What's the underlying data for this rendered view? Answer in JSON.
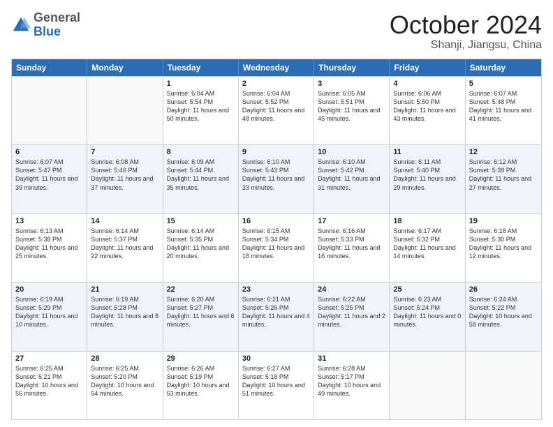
{
  "logo": {
    "general": "General",
    "blue": "Blue"
  },
  "header": {
    "month": "October 2024",
    "location": "Shanji, Jiangsu, China"
  },
  "weekdays": [
    "Sunday",
    "Monday",
    "Tuesday",
    "Wednesday",
    "Thursday",
    "Friday",
    "Saturday"
  ],
  "rows": [
    [
      {
        "day": "",
        "empty": true
      },
      {
        "day": "",
        "empty": true
      },
      {
        "day": "1",
        "sunrise": "6:04 AM",
        "sunset": "5:54 PM",
        "daylight": "11 hours and 50 minutes."
      },
      {
        "day": "2",
        "sunrise": "6:04 AM",
        "sunset": "5:52 PM",
        "daylight": "11 hours and 48 minutes."
      },
      {
        "day": "3",
        "sunrise": "6:05 AM",
        "sunset": "5:51 PM",
        "daylight": "11 hours and 45 minutes."
      },
      {
        "day": "4",
        "sunrise": "6:06 AM",
        "sunset": "5:50 PM",
        "daylight": "11 hours and 43 minutes."
      },
      {
        "day": "5",
        "sunrise": "6:07 AM",
        "sunset": "5:48 PM",
        "daylight": "11 hours and 41 minutes."
      }
    ],
    [
      {
        "day": "6",
        "sunrise": "6:07 AM",
        "sunset": "5:47 PM",
        "daylight": "11 hours and 39 minutes."
      },
      {
        "day": "7",
        "sunrise": "6:08 AM",
        "sunset": "5:46 PM",
        "daylight": "11 hours and 37 minutes."
      },
      {
        "day": "8",
        "sunrise": "6:09 AM",
        "sunset": "5:44 PM",
        "daylight": "11 hours and 35 minutes."
      },
      {
        "day": "9",
        "sunrise": "6:10 AM",
        "sunset": "5:43 PM",
        "daylight": "11 hours and 33 minutes."
      },
      {
        "day": "10",
        "sunrise": "6:10 AM",
        "sunset": "5:42 PM",
        "daylight": "11 hours and 31 minutes."
      },
      {
        "day": "11",
        "sunrise": "6:11 AM",
        "sunset": "5:40 PM",
        "daylight": "11 hours and 29 minutes."
      },
      {
        "day": "12",
        "sunrise": "6:12 AM",
        "sunset": "5:39 PM",
        "daylight": "11 hours and 27 minutes."
      }
    ],
    [
      {
        "day": "13",
        "sunrise": "6:13 AM",
        "sunset": "5:38 PM",
        "daylight": "11 hours and 25 minutes."
      },
      {
        "day": "14",
        "sunrise": "6:14 AM",
        "sunset": "5:37 PM",
        "daylight": "11 hours and 22 minutes."
      },
      {
        "day": "15",
        "sunrise": "6:14 AM",
        "sunset": "5:35 PM",
        "daylight": "11 hours and 20 minutes."
      },
      {
        "day": "16",
        "sunrise": "6:15 AM",
        "sunset": "5:34 PM",
        "daylight": "11 hours and 18 minutes."
      },
      {
        "day": "17",
        "sunrise": "6:16 AM",
        "sunset": "5:33 PM",
        "daylight": "11 hours and 16 minutes."
      },
      {
        "day": "18",
        "sunrise": "6:17 AM",
        "sunset": "5:32 PM",
        "daylight": "11 hours and 14 minutes."
      },
      {
        "day": "19",
        "sunrise": "6:18 AM",
        "sunset": "5:30 PM",
        "daylight": "11 hours and 12 minutes."
      }
    ],
    [
      {
        "day": "20",
        "sunrise": "6:19 AM",
        "sunset": "5:29 PM",
        "daylight": "11 hours and 10 minutes."
      },
      {
        "day": "21",
        "sunrise": "6:19 AM",
        "sunset": "5:28 PM",
        "daylight": "11 hours and 8 minutes."
      },
      {
        "day": "22",
        "sunrise": "6:20 AM",
        "sunset": "5:27 PM",
        "daylight": "11 hours and 6 minutes."
      },
      {
        "day": "23",
        "sunrise": "6:21 AM",
        "sunset": "5:26 PM",
        "daylight": "11 hours and 4 minutes."
      },
      {
        "day": "24",
        "sunrise": "6:22 AM",
        "sunset": "5:25 PM",
        "daylight": "11 hours and 2 minutes."
      },
      {
        "day": "25",
        "sunrise": "6:23 AM",
        "sunset": "5:24 PM",
        "daylight": "11 hours and 0 minutes."
      },
      {
        "day": "26",
        "sunrise": "6:24 AM",
        "sunset": "5:22 PM",
        "daylight": "10 hours and 58 minutes."
      }
    ],
    [
      {
        "day": "27",
        "sunrise": "6:25 AM",
        "sunset": "5:21 PM",
        "daylight": "10 hours and 56 minutes."
      },
      {
        "day": "28",
        "sunrise": "6:25 AM",
        "sunset": "5:20 PM",
        "daylight": "10 hours and 54 minutes."
      },
      {
        "day": "29",
        "sunrise": "6:26 AM",
        "sunset": "5:19 PM",
        "daylight": "10 hours and 53 minutes."
      },
      {
        "day": "30",
        "sunrise": "6:27 AM",
        "sunset": "5:18 PM",
        "daylight": "10 hours and 51 minutes."
      },
      {
        "day": "31",
        "sunrise": "6:28 AM",
        "sunset": "5:17 PM",
        "daylight": "10 hours and 49 minutes."
      },
      {
        "day": "",
        "empty": true
      },
      {
        "day": "",
        "empty": true
      }
    ]
  ]
}
